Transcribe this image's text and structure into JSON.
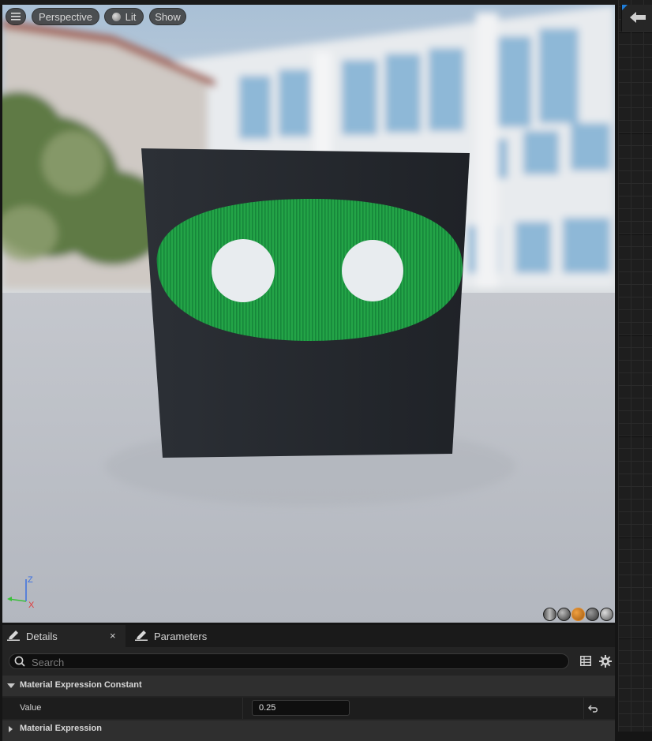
{
  "viewport": {
    "perspective_label": "Perspective",
    "lit_label": "Lit",
    "show_label": "Show",
    "axis": {
      "z": "Z",
      "x": "X"
    }
  },
  "details_panel": {
    "tabs": [
      {
        "label": "Details"
      },
      {
        "label": "Parameters"
      }
    ],
    "close_symbol": "×",
    "search_placeholder": "Search",
    "categories": [
      {
        "title": "Material Expression Constant",
        "properties": [
          {
            "label": "Value",
            "value": "0.25"
          }
        ]
      },
      {
        "title": "Material Expression"
      }
    ]
  },
  "colors": {
    "accent_blue": "#1f7dd8",
    "panel_bg": "#242424",
    "green_shape": "#1f9a3a"
  }
}
